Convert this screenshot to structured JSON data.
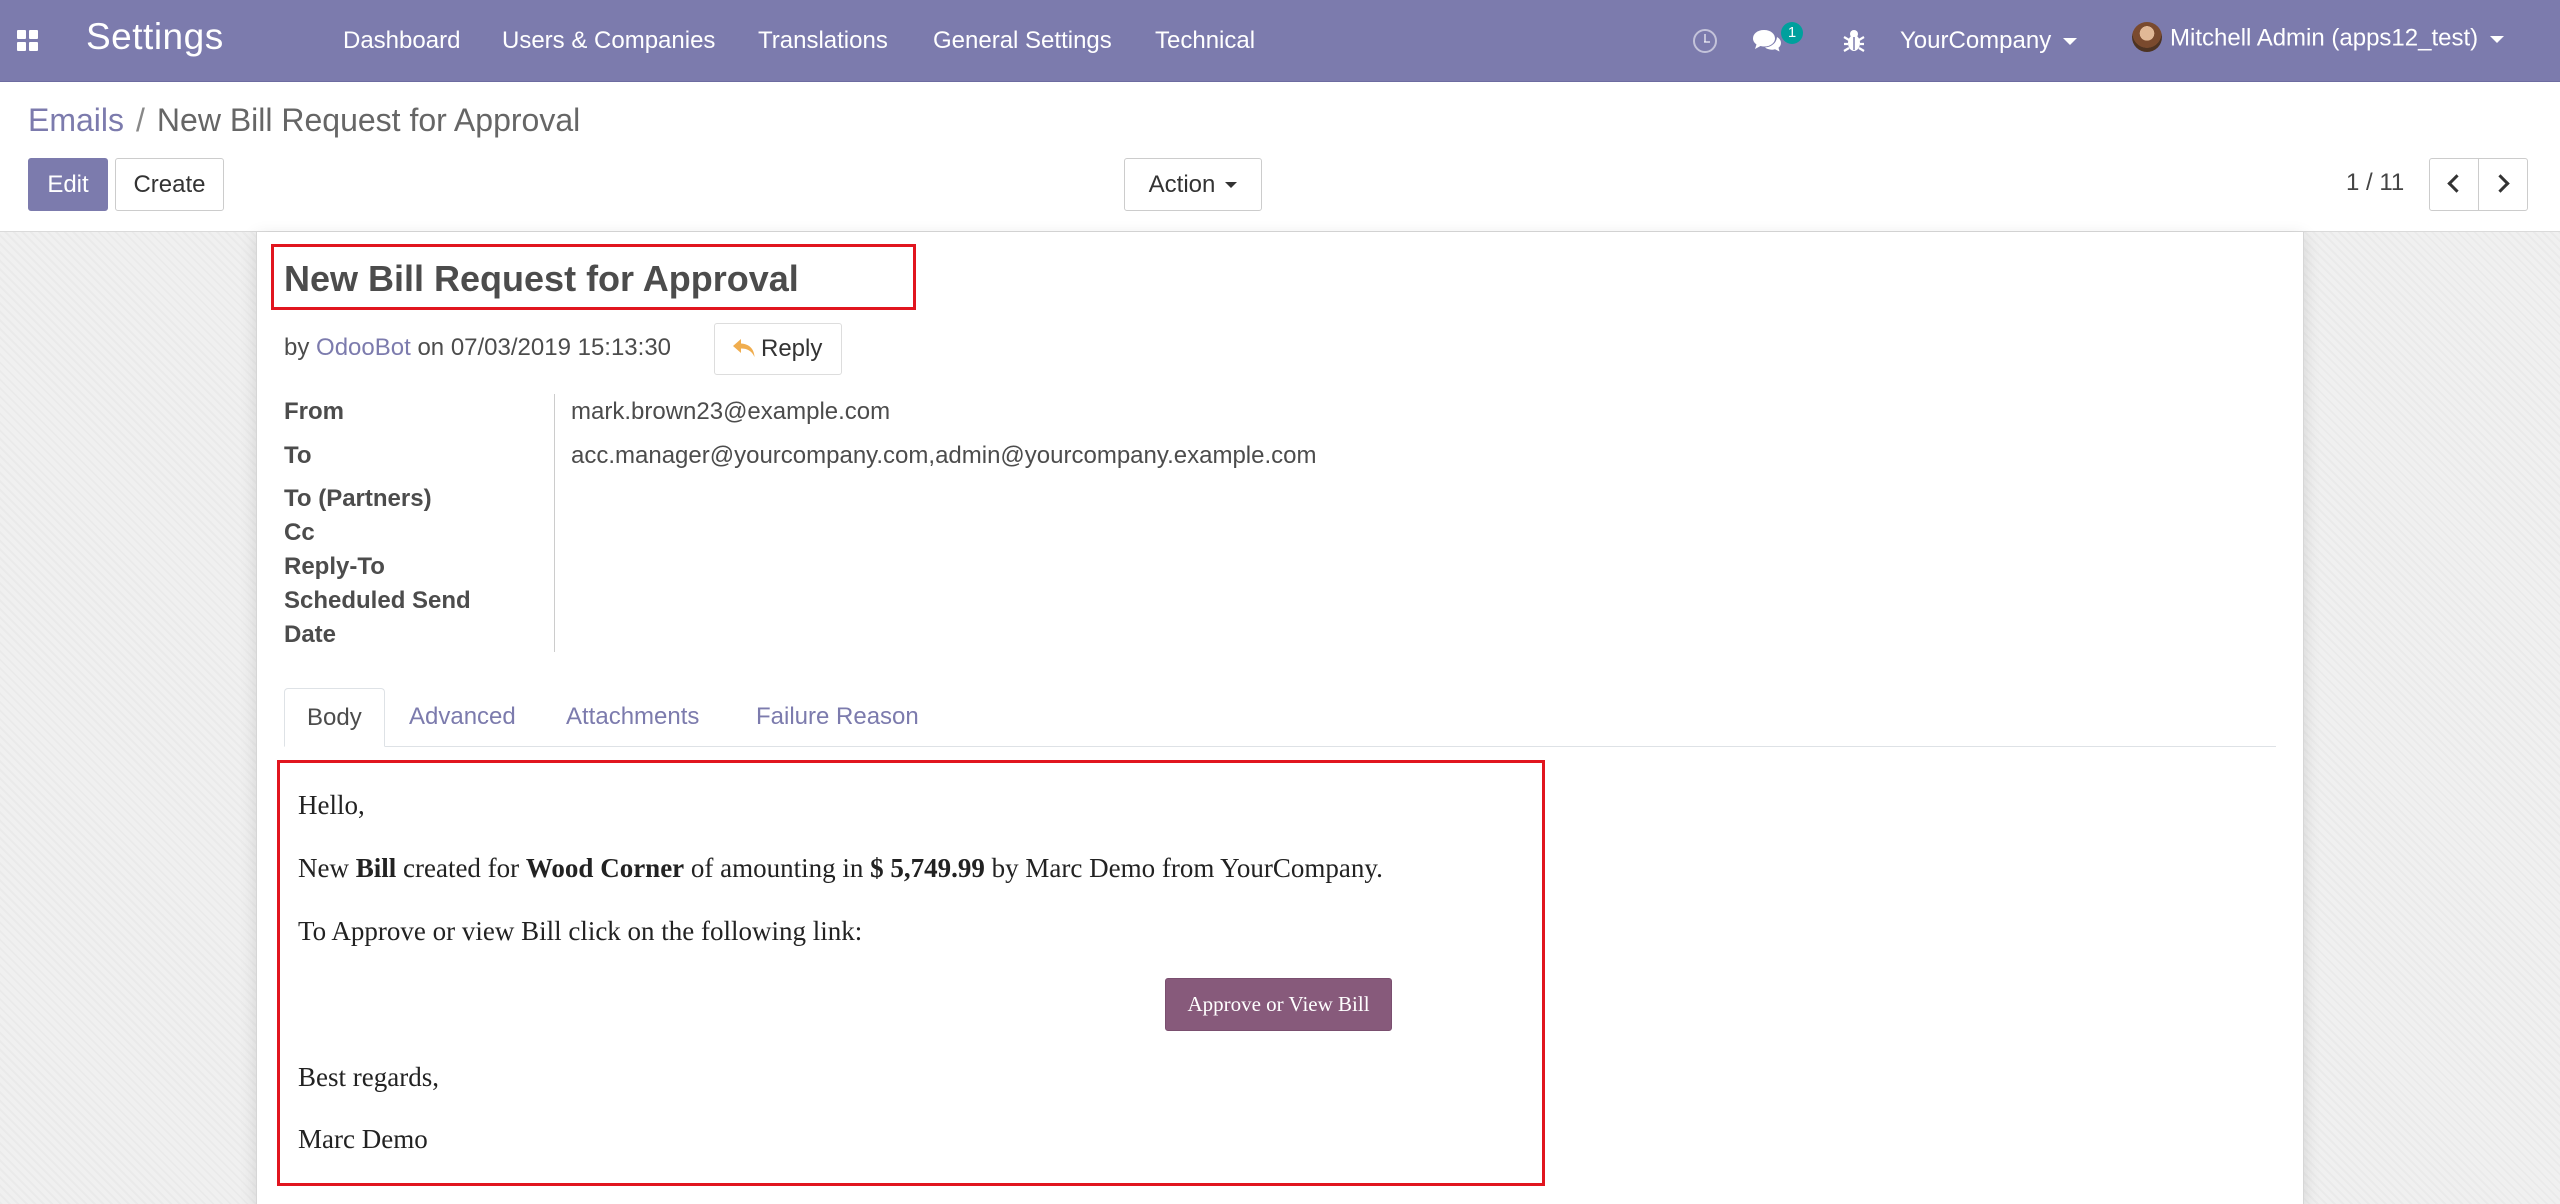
{
  "app": {
    "title": "Settings"
  },
  "menu": {
    "dashboard": "Dashboard",
    "users_companies": "Users & Companies",
    "translations": "Translations",
    "general_settings": "General Settings",
    "technical": "Technical"
  },
  "systray": {
    "messages_count": "1",
    "company": "YourCompany",
    "user": "Mitchell Admin (apps12_test)"
  },
  "breadcrumb": {
    "parent": "Emails",
    "separator": "/",
    "current": "New Bill Request for Approval"
  },
  "toolbar": {
    "edit_label": "Edit",
    "create_label": "Create",
    "action_label": "Action",
    "pager": "1 / 11"
  },
  "email": {
    "subject": "New Bill Request for Approval",
    "by_prefix": "by",
    "author": "OdooBot",
    "on_prefix": "on",
    "date": "07/03/2019 15:13:30",
    "reply_label": "Reply",
    "fields": {
      "from_label": "From",
      "from_value": "mark.brown23@example.com",
      "to_label": "To",
      "to_value": "acc.manager@yourcompany.com,admin@yourcompany.example.com",
      "to_partners_label": "To (Partners)",
      "cc_label": "Cc",
      "reply_to_label": "Reply-To",
      "scheduled_label_1": "Scheduled Send",
      "scheduled_label_2": "Date"
    }
  },
  "tabs": {
    "body": "Body",
    "advanced": "Advanced",
    "attachments": "Attachments",
    "failure_reason": "Failure Reason"
  },
  "body": {
    "greeting": "Hello,",
    "line_new": "New",
    "line_bill": "Bill",
    "line_created_for": "created for",
    "line_vendor": "Wood Corner",
    "line_of_amounting_in": "of amounting in",
    "line_amount": "$ 5,749.99",
    "line_rest": "by Marc Demo from YourCompany.",
    "instruction": "To Approve or view Bill click on the following link:",
    "approve_button": "Approve or View Bill",
    "regards": "Best regards,",
    "signature": "Marc Demo"
  },
  "colors": {
    "navbar": "#7c7bad",
    "primary": "#7c7bad",
    "highlight_box": "#e1151f",
    "approve_button": "#875a7b",
    "badge": "#00a09d"
  },
  "icons": [
    "apps-icon",
    "clock-icon",
    "chat-icon",
    "bug-icon",
    "chevron-left-icon",
    "chevron-right-icon",
    "reply-icon"
  ]
}
